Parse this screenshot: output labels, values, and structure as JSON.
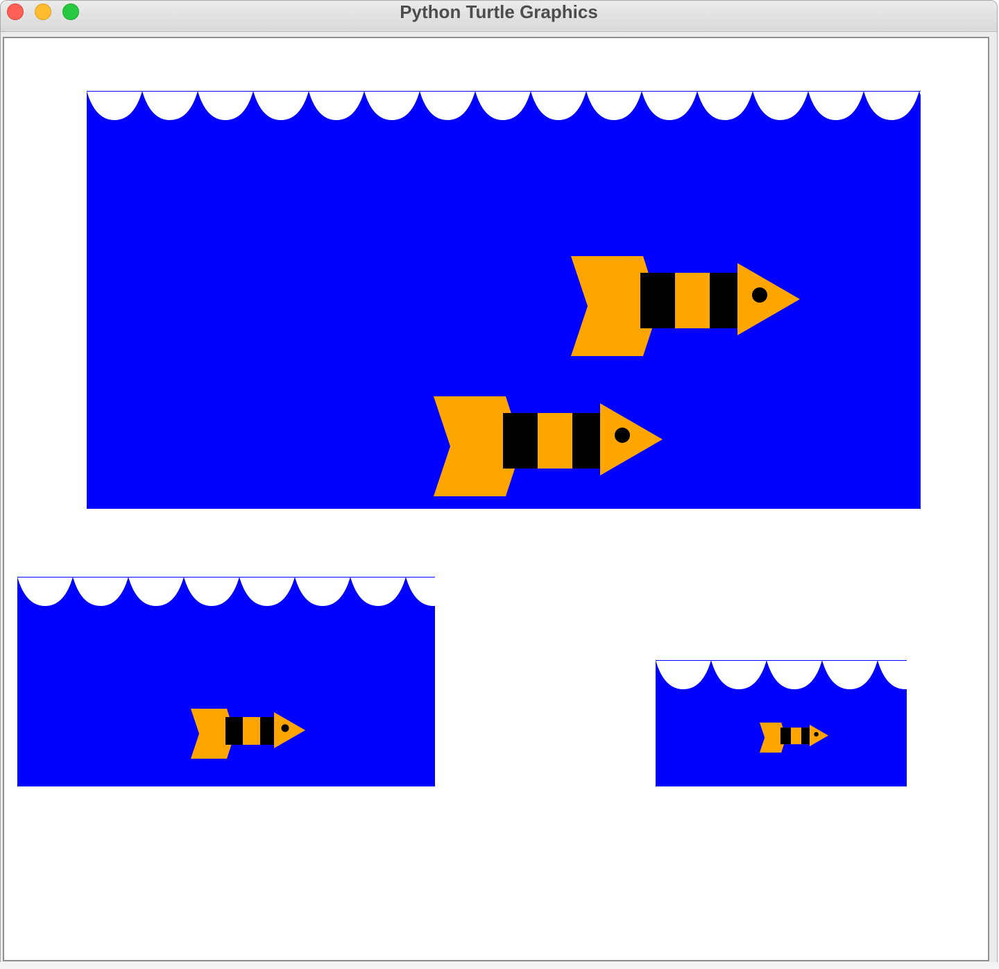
{
  "window": {
    "title": "Python Turtle Graphics"
  },
  "titlebar_buttons": [
    "close",
    "minimize",
    "zoom"
  ],
  "colors": {
    "water": "#0000ff",
    "wave": "#ffffff",
    "fish_body": "#ffa500",
    "fish_stripe": "#000000",
    "background": "#ffffff"
  },
  "scenes": [
    {
      "name": "large-aquarium",
      "fish_count": 2
    },
    {
      "name": "medium-aquarium",
      "fish_count": 1
    },
    {
      "name": "small-aquarium",
      "fish_count": 1
    }
  ]
}
